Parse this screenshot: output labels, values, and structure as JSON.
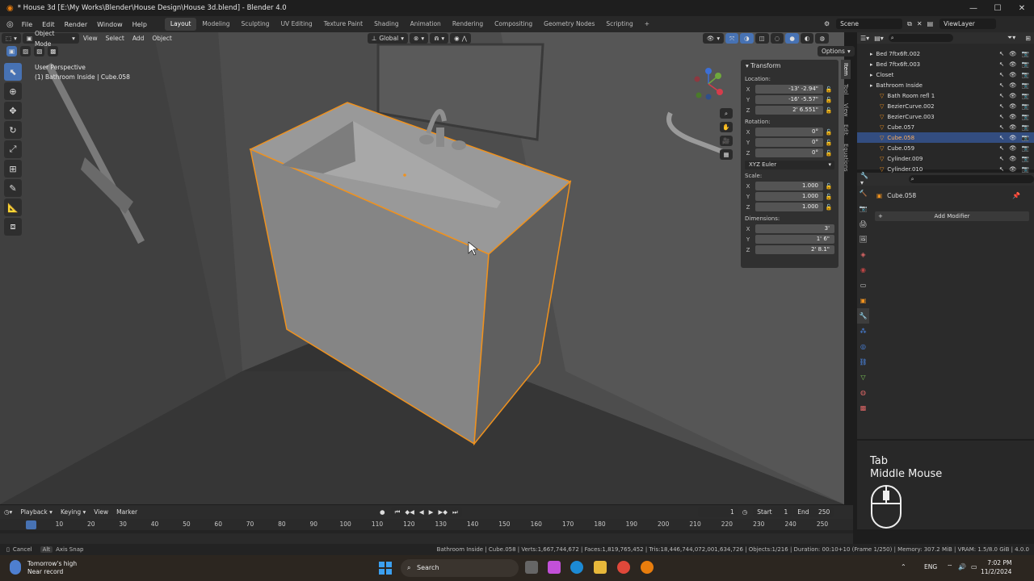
{
  "window": {
    "title": "* House 3d [E:\\My Works\\Blender\\House Design\\House 3d.blend] - Blender 4.0",
    "minimize": "—",
    "maximize": "☐",
    "close": "✕"
  },
  "menubar": {
    "items": [
      "File",
      "Edit",
      "Render",
      "Window",
      "Help"
    ],
    "workspaces": [
      "Layout",
      "Modeling",
      "Sculpting",
      "UV Editing",
      "Texture Paint",
      "Shading",
      "Animation",
      "Rendering",
      "Compositing",
      "Geometry Nodes",
      "Scripting"
    ],
    "active_workspace": "Layout",
    "add_workspace": "+",
    "scene_label": "Scene",
    "view_layer_label": "ViewLayer"
  },
  "viewport_header": {
    "mode": "Object Mode",
    "menus": [
      "View",
      "Select",
      "Add",
      "Object"
    ],
    "transform_orientation": "Global",
    "options_label": "Options"
  },
  "viewport": {
    "perspective_label": "User Perspective",
    "object_label": "(1) Bathroom Inside | Cube.058",
    "gizmo_labels": {
      "z": "Z",
      "y": "Y",
      "x": "X"
    }
  },
  "npanel": {
    "section": "Transform",
    "location_label": "Location:",
    "location": [
      {
        "axis": "X",
        "value": "-13' -2.94\""
      },
      {
        "axis": "Y",
        "value": "-16' -5.57\""
      },
      {
        "axis": "Z",
        "value": "2' 6.551\""
      }
    ],
    "rotation_label": "Rotation:",
    "rotation": [
      {
        "axis": "X",
        "value": "0°"
      },
      {
        "axis": "Y",
        "value": "0°"
      },
      {
        "axis": "Z",
        "value": "0°"
      }
    ],
    "rotation_mode": "XYZ Euler",
    "scale_label": "Scale:",
    "scale": [
      {
        "axis": "X",
        "value": "1.000"
      },
      {
        "axis": "Y",
        "value": "1.000"
      },
      {
        "axis": "Z",
        "value": "1.000"
      }
    ],
    "dimensions_label": "Dimensions:",
    "dimensions": [
      {
        "axis": "X",
        "value": "3'"
      },
      {
        "axis": "Y",
        "value": "1' 6\""
      },
      {
        "axis": "Z",
        "value": "2' 8.1\""
      }
    ],
    "side_tabs": [
      "Item",
      "Tool",
      "View",
      "Edit",
      "Equations"
    ]
  },
  "outliner": {
    "rows": [
      {
        "name": "Bed 7ftx6ft.002",
        "selected": false,
        "indent": 1
      },
      {
        "name": "Bed 7ftx6ft.003",
        "selected": false,
        "indent": 1
      },
      {
        "name": "Closet",
        "selected": false,
        "indent": 1
      },
      {
        "name": "Bathroom Inside",
        "selected": false,
        "indent": 1
      },
      {
        "name": "Bath Room refl 1",
        "selected": false,
        "indent": 2
      },
      {
        "name": "BezierCurve.002",
        "selected": false,
        "indent": 2
      },
      {
        "name": "BezierCurve.003",
        "selected": false,
        "indent": 2
      },
      {
        "name": "Cube.057",
        "selected": false,
        "indent": 2
      },
      {
        "name": "Cube.058",
        "selected": true,
        "indent": 2
      },
      {
        "name": "Cube.059",
        "selected": false,
        "indent": 2
      },
      {
        "name": "Cylinder.009",
        "selected": false,
        "indent": 2
      },
      {
        "name": "Cylinder.010",
        "selected": false,
        "indent": 2
      }
    ]
  },
  "properties": {
    "object_name": "Cube.058",
    "add_modifier_label": "Add Modifier"
  },
  "key_overlay": {
    "line1": "Tab",
    "line2": "Middle Mouse"
  },
  "timeline": {
    "menus": [
      "Playback",
      "Keying",
      "View",
      "Marker"
    ],
    "current_frame": "1",
    "start_label": "Start",
    "start_value": "1",
    "end_label": "End",
    "end_value": "250",
    "ticks": [
      "1",
      "10",
      "20",
      "30",
      "40",
      "50",
      "60",
      "70",
      "80",
      "90",
      "100",
      "110",
      "120",
      "130",
      "140",
      "150",
      "160",
      "170",
      "180",
      "190",
      "200",
      "210",
      "220",
      "230",
      "240",
      "250"
    ]
  },
  "statusbar": {
    "cancel": "Cancel",
    "alt_key": "Alt",
    "axis_snap": "Axis Snap",
    "stats": "Bathroom Inside | Cube.058 | Verts:1,667,744,672 | Faces:1,819,765,452 | Tris:18,446,744,072,001,634,726 | Objects:1/216 | Duration: 00:10+10 (Frame 1/250) | Memory: 307.2 MiB | VRAM: 1.5/8.0 GiB | 4.0.0"
  },
  "taskbar": {
    "weather_title": "Tomorrow's high",
    "weather_sub": "Near record",
    "search_label": "Search",
    "language": "ENG",
    "time": "7:02 PM",
    "date": "11/2/2024"
  },
  "colors": {
    "accent_blue": "#4772b3",
    "selection_orange": "#f0921e",
    "selected_row": "#334d80"
  }
}
